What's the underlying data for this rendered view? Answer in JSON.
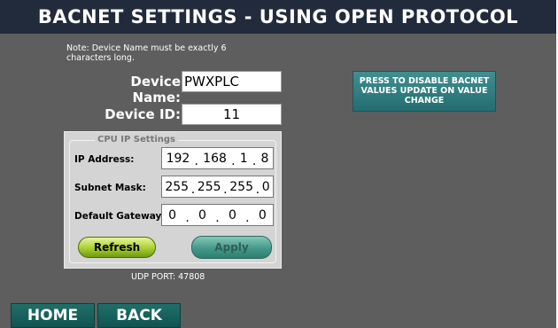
{
  "title": "BACNET SETTINGS - USING OPEN PROTOCOL",
  "note": "Note: Device Name must be exactly 6 characters long.",
  "device_name": {
    "label": "Device Name:",
    "value": "PWXPLC"
  },
  "device_id": {
    "label": "Device ID:",
    "value": "11"
  },
  "cpu_ip": {
    "legend": "CPU IP Settings",
    "ip_address": {
      "label": "IP Address:",
      "octets": [
        "192",
        "168",
        "1",
        "8"
      ]
    },
    "subnet_mask": {
      "label": "Subnet Mask:",
      "octets": [
        "255",
        "255",
        "255",
        "0"
      ]
    },
    "default_gateway": {
      "label": "Default Gateway:",
      "octets": [
        "0",
        "0",
        "0",
        "0"
      ]
    },
    "separator": "."
  },
  "buttons": {
    "refresh": "Refresh",
    "apply": "Apply",
    "disable_update": "PRESS TO DISABLE BACNET VALUES UPDATE ON VALUE CHANGE",
    "home": "HOME",
    "back": "BACK"
  },
  "udp_port": "UDP PORT: 47808",
  "colors": {
    "background": "#5e5e5e",
    "titlebar": "#222b3c",
    "accent_teal": "#256d70",
    "refresh_green": "#a9cf30"
  }
}
